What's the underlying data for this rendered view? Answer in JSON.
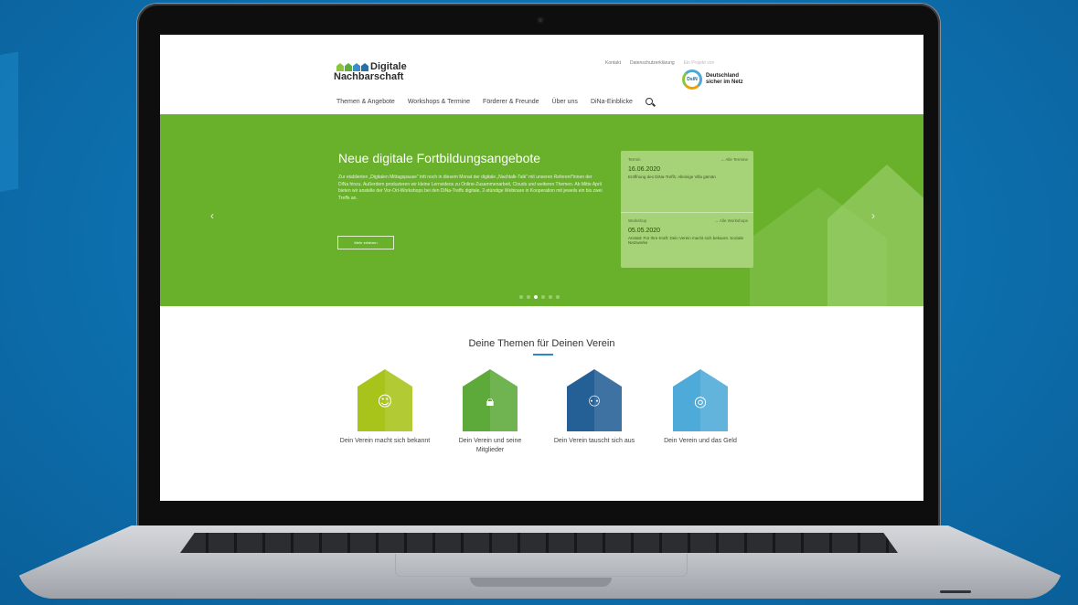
{
  "brand": {
    "name_line1": "Digitale",
    "name_line2": "Nachbarschaft",
    "house_colors": [
      "#8cc63f",
      "#5fae3a",
      "#3a8fc9",
      "#2a6fa8"
    ]
  },
  "topbar": {
    "links": [
      "Kontakt",
      "Datenschutzerklärung"
    ],
    "faded": "Ein Projekt von",
    "partner": "Deutschland sicher im Netz",
    "partner_short": "DsiN"
  },
  "nav": {
    "items": [
      "Themen & Angebote",
      "Workshops & Termine",
      "Förderer & Freunde",
      "Über uns",
      "DiNa-Einblicke"
    ],
    "search_icon": "search-icon"
  },
  "hero": {
    "title": "Neue digitale Fortbildungsangebote",
    "text": "Zur etablierten „Digitalen Mittagspause“ tritt noch in diesem Monat der digitale „Nachtalk-Talk“ mit unseren Referent*innen der DiNa hinzu. Außerdem produzieren wir kleine Lernvideos zu Online-Zusammenarbeit, Clouds und weiteren Themen. Ab Mitte April bieten wir anstelle der Vor-Ort-Workshops bei den DiNa-Treffs digitale, 2-stündige Webinare in Kooperation mit jeweils ein bis zwei Treffs an.",
    "button": "Mehr erfahren",
    "bg_color": "#69b12b",
    "arrow_left": "‹",
    "arrow_right": "›",
    "slide_count": 6,
    "active_slide": 3
  },
  "card": {
    "section1_label": "Termin",
    "section1_link": "→ Alle Termine",
    "date1": "16.06.2020",
    "text1": "Eröffnung des DiNa-Treffs: Alleinige Villa gämän",
    "section2_label": "Workshop",
    "section2_link": "→ Alle Workshops",
    "date2": "05.05.2020",
    "text2": "Anstatt: Für Ihre Kraft: Dein Verein macht sich bekannt. Soziale Netzwerke"
  },
  "themes": {
    "title": "Deine Themen für Deinen Verein",
    "accent": "#2a8ac8",
    "items": [
      {
        "label": "Dein Verein macht sich bekannt",
        "color": "#a8c41a",
        "icon": "speech-bubbles-icon"
      },
      {
        "label": "Dein Verein und seine Mitglieder",
        "color": "#5da93a",
        "icon": "lock-shield-icon"
      },
      {
        "label": "Dein Verein tauscht sich aus",
        "color": "#245f96",
        "icon": "people-chat-icon"
      },
      {
        "label": "Dein Verein und das Geld",
        "color": "#4eaad8",
        "icon": "piggy-bank-icon"
      }
    ]
  }
}
